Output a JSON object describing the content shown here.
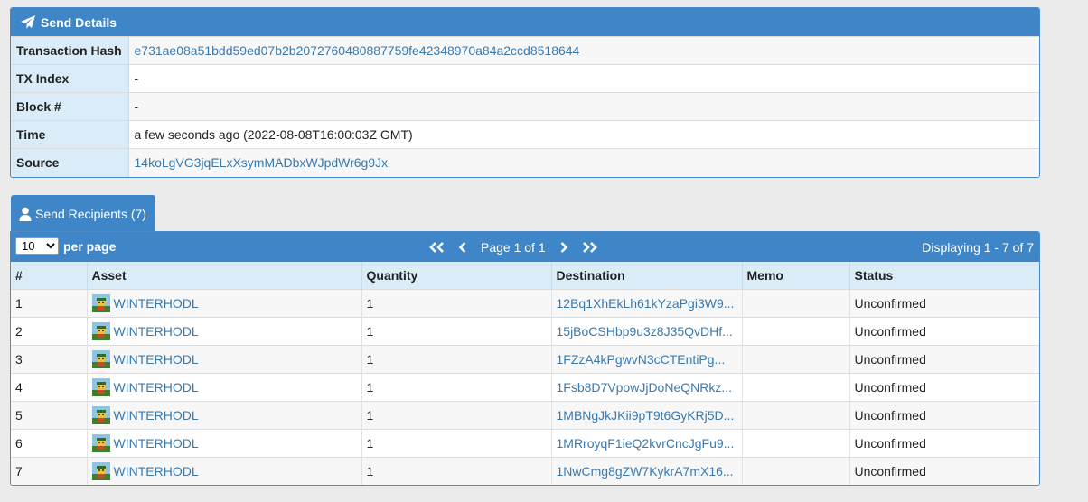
{
  "details": {
    "title": "Send Details",
    "rows": [
      {
        "label": "Transaction Hash",
        "value": "e731ae08a51bdd59ed07b2b2072760480887759fe42348970a84a2ccd8518644"
      },
      {
        "label": "TX Index",
        "value": "-"
      },
      {
        "label": "Block #",
        "value": "-"
      },
      {
        "label": "Time",
        "value": "a few seconds ago (2022-08-08T16:00:03Z GMT)"
      },
      {
        "label": "Source",
        "value": "14koLgVG3jqELxXsymMADbxWJpdWr6g9Jx"
      }
    ]
  },
  "recipients": {
    "tab_label": "Send Recipients (7)",
    "per_page_value": "10",
    "per_page_label": "per page",
    "page_label": "Page 1 of 1",
    "displaying": "Displaying 1 - 7 of 7",
    "columns": [
      "#",
      "Asset",
      "Quantity",
      "Destination",
      "Memo",
      "Status"
    ],
    "rows": [
      {
        "num": "1",
        "asset": "WINTERHODL",
        "quantity": "1",
        "destination": "12Bq1XhEkLh61kYzaPgi3W9...",
        "memo": "",
        "status": "Unconfirmed"
      },
      {
        "num": "2",
        "asset": "WINTERHODL",
        "quantity": "1",
        "destination": "15jBoCSHbp9u3z8J35QvDHf...",
        "memo": "",
        "status": "Unconfirmed"
      },
      {
        "num": "3",
        "asset": "WINTERHODL",
        "quantity": "1",
        "destination": "1FZzA4kPgwvN3cCTEntiPg...",
        "memo": "",
        "status": "Unconfirmed"
      },
      {
        "num": "4",
        "asset": "WINTERHODL",
        "quantity": "1",
        "destination": "1Fsb8D7VpowJjDoNeQNRkz...",
        "memo": "",
        "status": "Unconfirmed"
      },
      {
        "num": "5",
        "asset": "WINTERHODL",
        "quantity": "1",
        "destination": "1MBNgJkJKii9pT9t6GyKRj5D...",
        "memo": "",
        "status": "Unconfirmed"
      },
      {
        "num": "6",
        "asset": "WINTERHODL",
        "quantity": "1",
        "destination": "1MRroyqF1ieQ2kvrCncJgFu9...",
        "memo": "",
        "status": "Unconfirmed"
      },
      {
        "num": "7",
        "asset": "WINTERHODL",
        "quantity": "1",
        "destination": "1NwCmg8gZW7KykrA7mX16...",
        "memo": "",
        "status": "Unconfirmed"
      }
    ]
  },
  "icons": {
    "header": "paper-plane-icon",
    "tab": "user-icon",
    "asset": "asset-thumbnail-icon",
    "first": "double-chevron-left-icon",
    "prev": "chevron-left-icon",
    "next": "chevron-right-icon",
    "last": "double-chevron-right-icon"
  },
  "colors": {
    "accent": "#3f86c8",
    "key_bg": "#d9ecf7",
    "link": "#3a79ad"
  }
}
